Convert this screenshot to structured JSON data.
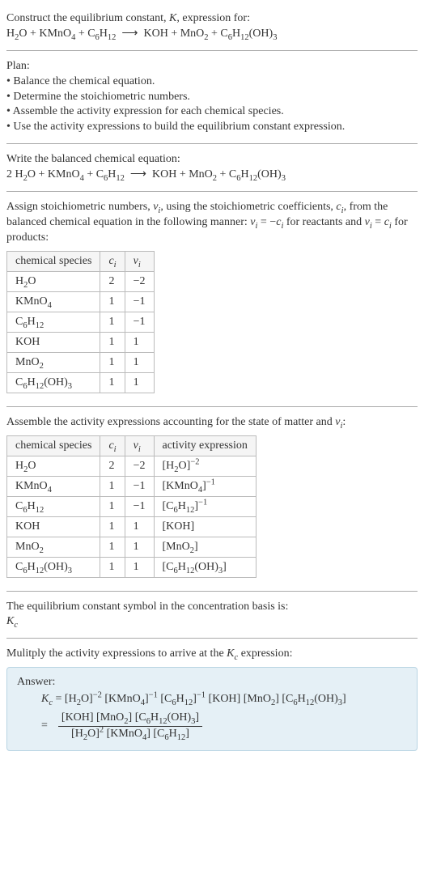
{
  "prompt": {
    "line1": "Construct the equilibrium constant, K, expression for:",
    "line2": "H₂O + KMnO₄ + C₆H₁₂ ⟶ KOH + MnO₂ + C₆H₁₂(OH)₃"
  },
  "plan": {
    "heading": "Plan:",
    "items": [
      "• Balance the chemical equation.",
      "• Determine the stoichiometric numbers.",
      "• Assemble the activity expression for each chemical species.",
      "• Use the activity expressions to build the equilibrium constant expression."
    ]
  },
  "balanced": {
    "heading": "Write the balanced chemical equation:",
    "equation": "2 H₂O + KMnO₄ + C₆H₁₂ ⟶ KOH + MnO₂ + C₆H₁₂(OH)₃"
  },
  "stoich": {
    "intro": "Assign stoichiometric numbers, νᵢ, using the stoichiometric coefficients, cᵢ, from the balanced chemical equation in the following manner: νᵢ = −cᵢ for reactants and νᵢ = cᵢ for products:",
    "headers": [
      "chemical species",
      "cᵢ",
      "νᵢ"
    ],
    "rows": [
      {
        "species": "H₂O",
        "c": "2",
        "v": "−2"
      },
      {
        "species": "KMnO₄",
        "c": "1",
        "v": "−1"
      },
      {
        "species": "C₆H₁₂",
        "c": "1",
        "v": "−1"
      },
      {
        "species": "KOH",
        "c": "1",
        "v": "1"
      },
      {
        "species": "MnO₂",
        "c": "1",
        "v": "1"
      },
      {
        "species": "C₆H₁₂(OH)₃",
        "c": "1",
        "v": "1"
      }
    ]
  },
  "activity": {
    "intro": "Assemble the activity expressions accounting for the state of matter and νᵢ:",
    "headers": [
      "chemical species",
      "cᵢ",
      "νᵢ",
      "activity expression"
    ],
    "rows": [
      {
        "species": "H₂O",
        "c": "2",
        "v": "−2",
        "expr": "[H₂O]⁻²"
      },
      {
        "species": "KMnO₄",
        "c": "1",
        "v": "−1",
        "expr": "[KMnO₄]⁻¹"
      },
      {
        "species": "C₆H₁₂",
        "c": "1",
        "v": "−1",
        "expr": "[C₆H₁₂]⁻¹"
      },
      {
        "species": "KOH",
        "c": "1",
        "v": "1",
        "expr": "[KOH]"
      },
      {
        "species": "MnO₂",
        "c": "1",
        "v": "1",
        "expr": "[MnO₂]"
      },
      {
        "species": "C₆H₁₂(OH)₃",
        "c": "1",
        "v": "1",
        "expr": "[C₆H₁₂(OH)₃]"
      }
    ]
  },
  "symbol": {
    "line1": "The equilibrium constant symbol in the concentration basis is:",
    "line2": "K_c"
  },
  "multiply": {
    "line": "Mulitply the activity expressions to arrive at the K_c expression:"
  },
  "answer": {
    "label": "Answer:",
    "line1": "K_c = [H₂O]⁻² [KMnO₄]⁻¹ [C₆H₁₂]⁻¹ [KOH] [MnO₂] [C₆H₁₂(OH)₃]",
    "eq": "=",
    "num": "[KOH] [MnO₂] [C₆H₁₂(OH)₃]",
    "den": "[H₂O]² [KMnO₄] [C₆H₁₂]"
  },
  "chart_data": [
    {
      "type": "table",
      "title": "Stoichiometric numbers",
      "columns": [
        "chemical species",
        "c_i",
        "ν_i"
      ],
      "rows": [
        [
          "H₂O",
          2,
          -2
        ],
        [
          "KMnO₄",
          1,
          -1
        ],
        [
          "C₆H₁₂",
          1,
          -1
        ],
        [
          "KOH",
          1,
          1
        ],
        [
          "MnO₂",
          1,
          1
        ],
        [
          "C₆H₁₂(OH)₃",
          1,
          1
        ]
      ]
    },
    {
      "type": "table",
      "title": "Activity expressions",
      "columns": [
        "chemical species",
        "c_i",
        "ν_i",
        "activity expression"
      ],
      "rows": [
        [
          "H₂O",
          2,
          -2,
          "[H₂O]^-2"
        ],
        [
          "KMnO₄",
          1,
          -1,
          "[KMnO₄]^-1"
        ],
        [
          "C₆H₁₂",
          1,
          -1,
          "[C₆H₁₂]^-1"
        ],
        [
          "KOH",
          1,
          1,
          "[KOH]"
        ],
        [
          "MnO₂",
          1,
          1,
          "[MnO₂]"
        ],
        [
          "C₆H₁₂(OH)₃",
          1,
          1,
          "[C₆H₁₂(OH)₃]"
        ]
      ]
    }
  ]
}
